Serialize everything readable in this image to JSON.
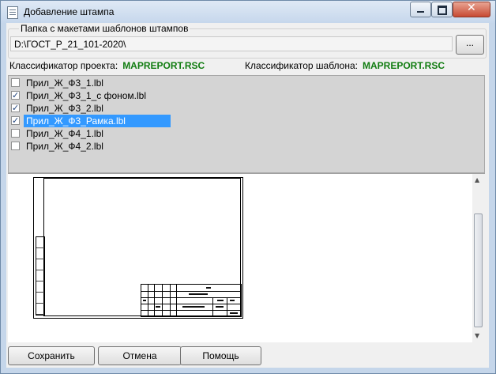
{
  "window": {
    "title": "Добавление штампа"
  },
  "folder": {
    "group_label": "Папка с макетами шаблонов штампов",
    "path": "D:\\ГОСТ_Р_21_101-2020\\",
    "browse_label": "..."
  },
  "classifiers": {
    "project_label": "Классификатор проекта:",
    "project_value": "MAPREPORT.RSC",
    "template_label": "Классификатор шаблона:",
    "template_value": "MAPREPORT.RSC"
  },
  "templates": [
    {
      "label": "Прил_Ж_Ф3_1.lbl",
      "checked": false,
      "selected": false
    },
    {
      "label": "Прил_Ж_Ф3_1_с фоном.lbl",
      "checked": true,
      "selected": false
    },
    {
      "label": "Прил_Ж_Ф3_2.lbl",
      "checked": true,
      "selected": false
    },
    {
      "label": "Прил_Ж_Ф3_Рамка.lbl",
      "checked": true,
      "selected": true
    },
    {
      "label": "Прил_Ж_Ф4_1.lbl",
      "checked": false,
      "selected": false
    },
    {
      "label": "Прил_Ж_Ф4_2.lbl",
      "checked": false,
      "selected": false
    }
  ],
  "buttons": {
    "save": "Сохранить",
    "cancel": "Отмена",
    "help": "Помощь"
  },
  "colors": {
    "classifier_value": "#107c10",
    "selection": "#3399ff",
    "list_bg": "#d4d4d4"
  }
}
